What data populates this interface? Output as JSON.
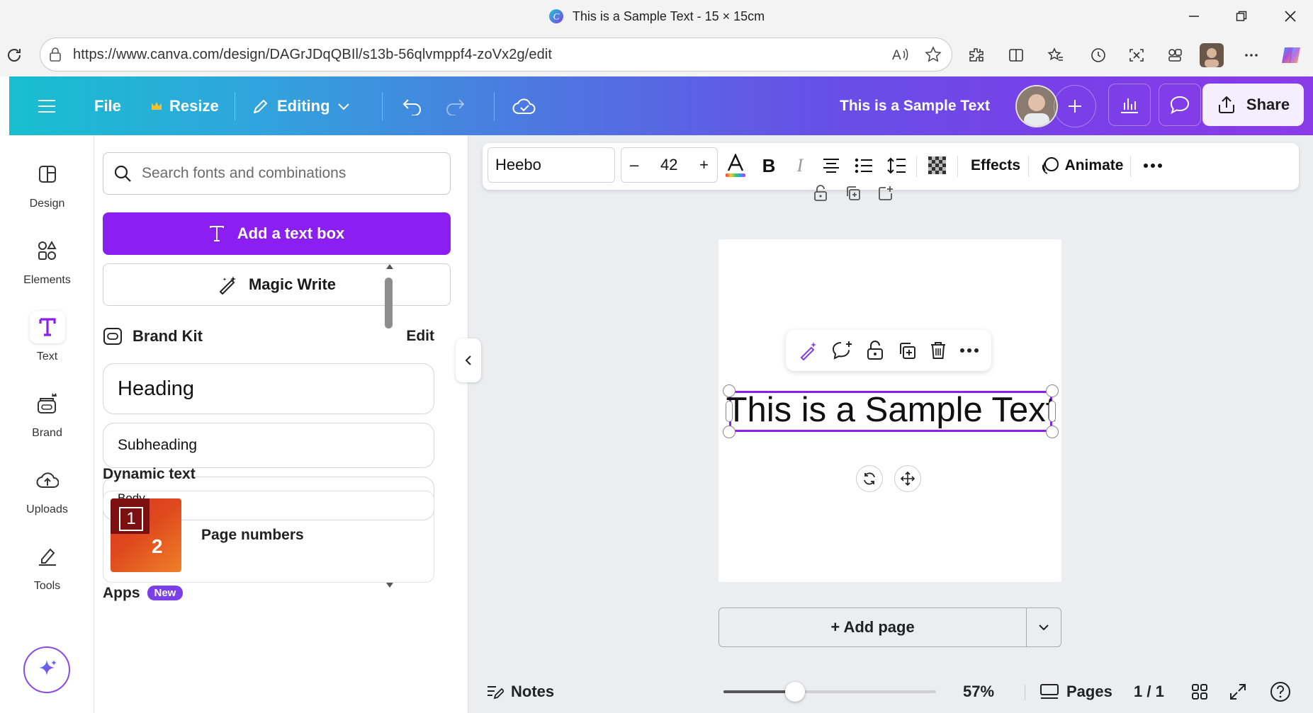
{
  "window": {
    "title": "This is a Sample Text - 15 × 15cm"
  },
  "browser": {
    "url": "https://www.canva.com/design/DAGrJDqQBIl/s13b-56qlvmppf4-zoVx2g/edit"
  },
  "header": {
    "file_label": "File",
    "resize_label": "Resize",
    "editing_label": "Editing",
    "design_title": "This is a Sample Text",
    "share_label": "Share"
  },
  "rail": {
    "items": [
      {
        "label": "Design",
        "icon": "design-icon"
      },
      {
        "label": "Elements",
        "icon": "elements-icon"
      },
      {
        "label": "Text",
        "icon": "text-icon"
      },
      {
        "label": "Brand",
        "icon": "brand-icon"
      },
      {
        "label": "Uploads",
        "icon": "uploads-icon"
      },
      {
        "label": "Tools",
        "icon": "tools-icon"
      }
    ]
  },
  "panel": {
    "search_placeholder": "Search fonts and combinations",
    "add_text_box_label": "Add a text box",
    "magic_write_label": "Magic Write",
    "brand_kit_label": "Brand Kit",
    "brand_kit_edit": "Edit",
    "styles": [
      {
        "label": "Heading"
      },
      {
        "label": "Subheading"
      },
      {
        "label": "Body"
      }
    ],
    "dynamic_text_title": "Dynamic text",
    "page_numbers_label": "Page numbers",
    "thumb_num_1": "1",
    "thumb_num_2": "2",
    "apps_title": "Apps",
    "apps_badge": "New"
  },
  "toolbar": {
    "font_name": "Heebo",
    "font_size": "42",
    "minus": "–",
    "plus": "+",
    "effects_label": "Effects",
    "animate_label": "Animate"
  },
  "canvas": {
    "text": "This is a Sample Text",
    "add_page_label": "+ Add page"
  },
  "footer": {
    "notes_label": "Notes",
    "zoom": "57%",
    "zoom_value": 0.57,
    "pages_label": "Pages",
    "page_counter": "1 / 1"
  },
  "colors": {
    "accent": "#8b1ef0",
    "header_start": "#17bfd0",
    "header_end": "#8b3be8"
  }
}
